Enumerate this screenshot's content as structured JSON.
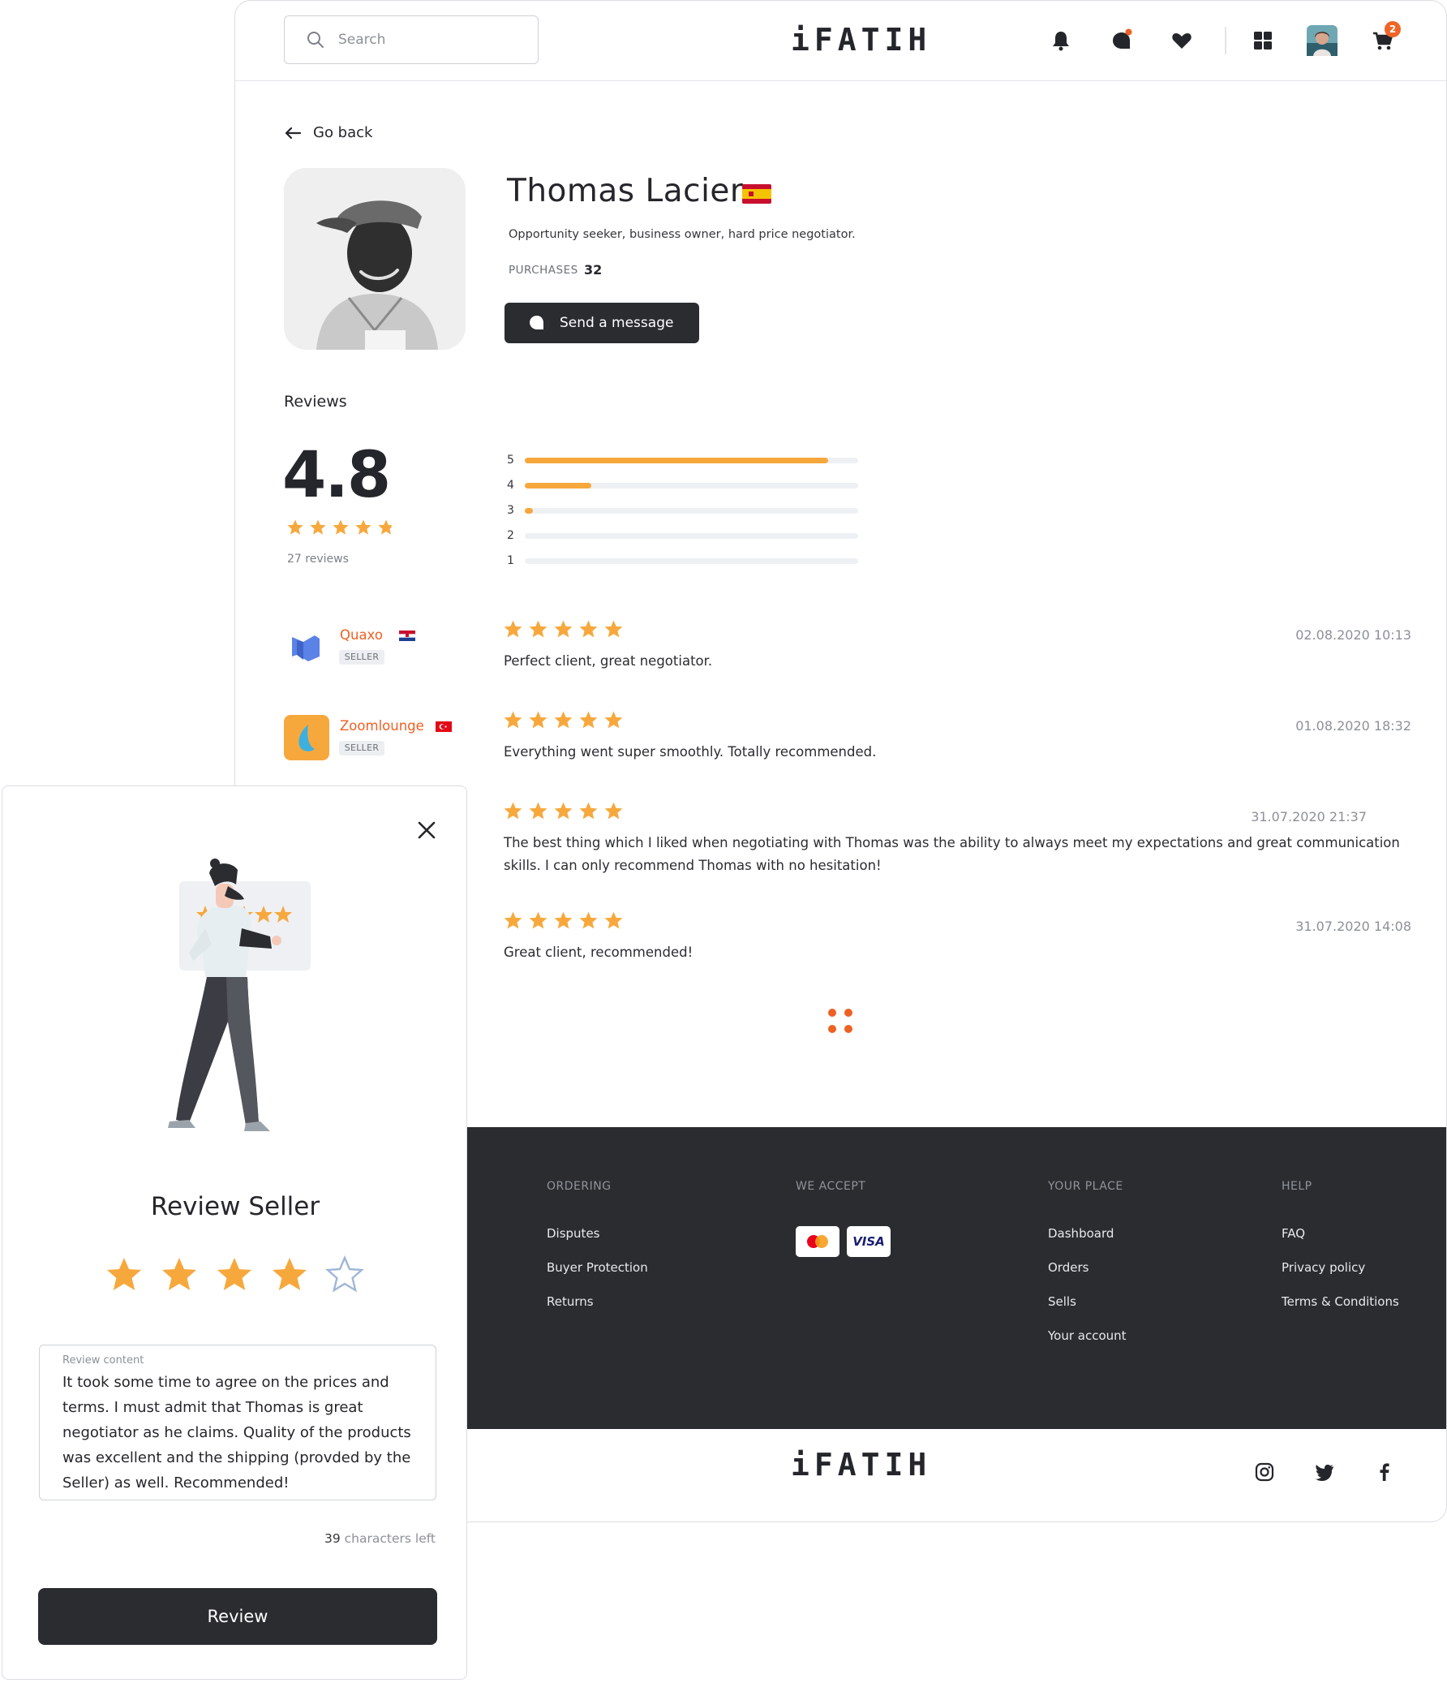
{
  "header": {
    "search_placeholder": "Search",
    "logo": "iFATIH",
    "cart_count": "2",
    "icons": [
      "search-icon",
      "bell-icon",
      "chat-icon",
      "heart-icon",
      "grid-icon",
      "user-avatar",
      "cart-icon"
    ]
  },
  "profile": {
    "go_back": "Go back",
    "name": "Thomas Lacier",
    "flag": "spain-flag",
    "bio": "Opportunity seeker, business owner, hard price negotiator.",
    "purchases_label": "PURCHASES",
    "purchases_value": "32",
    "message_button": "Send a message"
  },
  "reviews": {
    "title": "Reviews",
    "average": "4.8",
    "count_text": "27 reviews",
    "distribution": [
      {
        "label": "5",
        "fraction": 0.91
      },
      {
        "label": "4",
        "fraction": 0.2
      },
      {
        "label": "3",
        "fraction": 0.02
      },
      {
        "label": "2",
        "fraction": 0
      },
      {
        "label": "1",
        "fraction": 0
      }
    ],
    "items": [
      {
        "author": "Quaxo",
        "role": "SELLER",
        "rating": 5,
        "date": "02.08.2020 10:13",
        "text": "Perfect client, great negotiator."
      },
      {
        "author": "Zoomlounge",
        "role": "SELLER",
        "rating": 5,
        "date": "01.08.2020 18:32",
        "text": "Everything went super smoothly. Totally recommended."
      },
      {
        "author": "",
        "role": "",
        "rating": 5,
        "date": "31.07.2020 21:37",
        "text": "The best thing which I liked when negotiating with Thomas was the ability to always meet my expectations and great communication skills. I can only recommend Thomas with no hesitation!"
      },
      {
        "author": "",
        "role": "",
        "rating": 5,
        "date": "31.07.2020 14:08",
        "text": "Great client, recommended!"
      }
    ]
  },
  "footer": {
    "columns": [
      {
        "title": "ORDERING",
        "links": [
          "Disputes",
          "Buyer Protection",
          "Returns"
        ]
      },
      {
        "title": "WE ACCEPT",
        "links": []
      },
      {
        "title": "YOUR PLACE",
        "links": [
          "Dashboard",
          "Orders",
          "Sells",
          "Your account"
        ]
      },
      {
        "title": "HELP",
        "links": [
          "FAQ",
          "Privacy policy",
          "Terms & Conditions"
        ]
      }
    ],
    "payment_methods": [
      "mastercard",
      "VISA"
    ],
    "logo": "iFATIH",
    "social": [
      "instagram-icon",
      "twitter-icon",
      "facebook-icon"
    ]
  },
  "modal": {
    "title": "Review Seller",
    "rating": 4,
    "max_rating": 5,
    "content_label": "Review content",
    "content": "It took some time to agree on the prices and terms. I must admit that Thomas is great negotiator as he claims. Quality of the products was excellent and the shipping (provded by the Seller) as well. Recommended!",
    "chars_left_value": "39",
    "chars_left_label": "characters left",
    "submit": "Review"
  },
  "colors": {
    "accent": "#ee6023",
    "star": "#f7a83d",
    "dark": "#2b2c30"
  }
}
